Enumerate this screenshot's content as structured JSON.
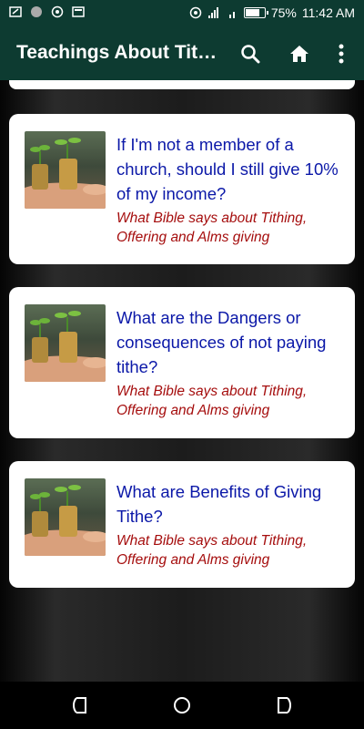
{
  "status_bar": {
    "battery": "75%",
    "time": "11:42 AM",
    "battery_level": 0.75
  },
  "app_bar": {
    "title": "Teachings About Tithing",
    "icons": [
      "search-icon",
      "home-icon",
      "more-vert-icon"
    ]
  },
  "cards": [
    {
      "title": " If I'm not a member of a church, should I still give 10% of my income?",
      "subtitle": "What Bible says about Tithing, Offering and Alms giving"
    },
    {
      "title": "What are the Dangers or consequences of not paying tithe?",
      "subtitle": "What Bible says about Tithing, Offering and Alms giving"
    },
    {
      "title": "What are Benefits of Giving Tithe?",
      "subtitle": "What Bible says about Tithing, Offering and Alms giving"
    }
  ],
  "colors": {
    "app_bar": "#0d3b31",
    "title_text": "#0b18a8",
    "subtitle_text": "#a50d0d"
  }
}
